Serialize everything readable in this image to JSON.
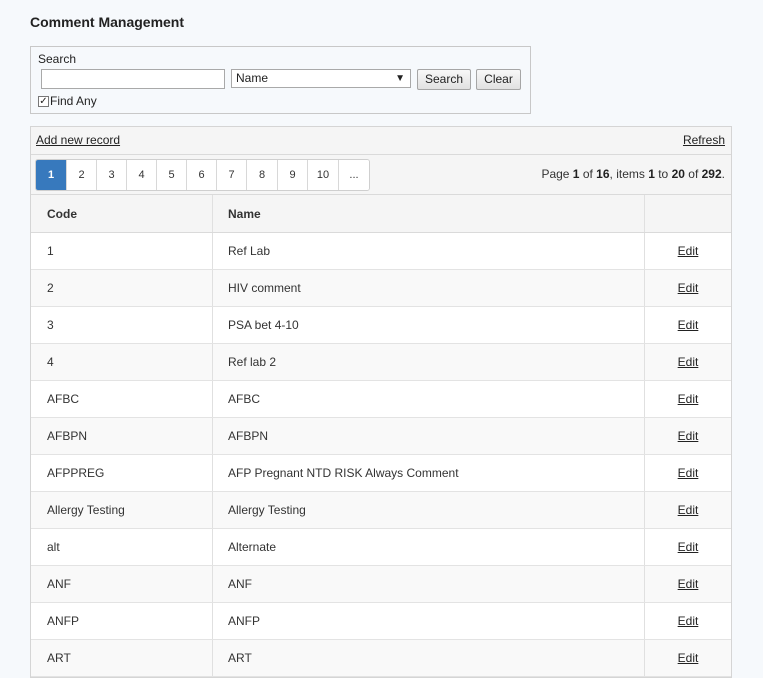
{
  "page": {
    "title": "Comment Management"
  },
  "search": {
    "label": "Search",
    "input_value": "",
    "select_value": "Name",
    "search_button": "Search",
    "clear_button": "Clear",
    "find_any_label": "Find Any",
    "find_any_checked": true
  },
  "toolbar": {
    "add_label": "Add new record",
    "refresh_label": "Refresh"
  },
  "pager": {
    "pages": [
      "1",
      "2",
      "3",
      "4",
      "5",
      "6",
      "7",
      "8",
      "9",
      "10",
      "..."
    ],
    "active_page": "1",
    "info": {
      "page_word": "Page ",
      "page": "1",
      "of_word": " of ",
      "page_count": "16",
      "items_word": ", items ",
      "from": "1",
      "to_word": " to ",
      "to": "20",
      "of_word2": " of ",
      "total": "292",
      "end": "."
    }
  },
  "table": {
    "columns": [
      "Code",
      "Name",
      ""
    ],
    "action_label": "Edit",
    "rows": [
      {
        "code": "1",
        "name": "Ref Lab"
      },
      {
        "code": "2",
        "name": "HIV comment"
      },
      {
        "code": "3",
        "name": "PSA bet 4-10"
      },
      {
        "code": "4",
        "name": "Ref lab 2"
      },
      {
        "code": "AFBC",
        "name": "AFBC"
      },
      {
        "code": "AFBPN",
        "name": "AFBPN"
      },
      {
        "code": "AFPPREG",
        "name": "AFP Pregnant NTD RISK Always Comment"
      },
      {
        "code": "Allergy Testing",
        "name": "Allergy Testing"
      },
      {
        "code": "alt",
        "name": "Alternate"
      },
      {
        "code": "ANF",
        "name": "ANF"
      },
      {
        "code": "ANFP",
        "name": "ANFP"
      },
      {
        "code": "ART",
        "name": "ART"
      }
    ]
  },
  "colors": {
    "active_page": "#3779bd",
    "background": "#f6f9fc"
  }
}
